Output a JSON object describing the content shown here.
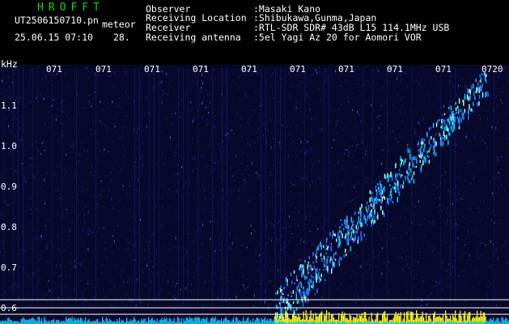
{
  "header": {
    "logo": "HROFFT",
    "filename": "UT2506150710.pn",
    "tag": "meteor",
    "datetime": "25.06.15 07:10",
    "partial": "28.",
    "fields": [
      {
        "label": "Observer",
        "value": ":Masaki Kano"
      },
      {
        "label": "Receiving Location",
        "value": ":Shibukawa,Gunma,Japan"
      },
      {
        "label": "Receiver",
        "value": ":RTL-SDR SDR# 43dB L15 114.1MHz USB"
      },
      {
        "label": "Receiving antenna",
        "value": ":5el Yagi Az 20 for Aomori VOR"
      }
    ]
  },
  "plot": {
    "unit": "kHz",
    "y_ticks": [
      "1.1",
      "1.0",
      "0.9",
      "0.8",
      "0.7",
      "0.6"
    ],
    "x_ticks": [
      "071",
      "071",
      "071",
      "071",
      "071",
      "071",
      "071",
      "071",
      "071",
      "0720"
    ],
    "colors": {
      "background": "#0a0a2e",
      "signal": "#00c8ff",
      "noise": "#ffff00",
      "marker": "#ffffff"
    }
  }
}
